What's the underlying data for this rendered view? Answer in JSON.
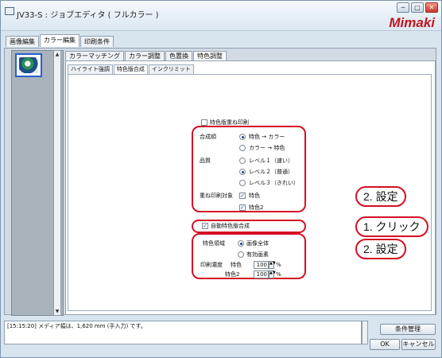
{
  "window": {
    "title": "JV33-S : ジョブエディタ ( フルカラー )",
    "brand": "Mimaki",
    "controls": [
      "─",
      "□",
      "✕"
    ]
  },
  "main_tabs": [
    {
      "label": "画像編集",
      "active": false
    },
    {
      "label": "カラー編集",
      "active": true
    },
    {
      "label": "印刷条件",
      "active": false
    }
  ],
  "sub_tabs": [
    {
      "label": "カラーマッチング",
      "active": false
    },
    {
      "label": "カラー調整",
      "active": false
    },
    {
      "label": "色置換",
      "active": false
    },
    {
      "label": "特色調整",
      "active": true
    }
  ],
  "subsub_tabs": [
    {
      "label": "ハイライト強調",
      "active": false
    },
    {
      "label": "特色版合成",
      "active": true
    },
    {
      "label": "インクリミット",
      "active": false
    }
  ],
  "special": {
    "overprint_label": "特色版重ね印刷",
    "compose_order_label": "合成順",
    "compose_options": [
      "特色 → カラー",
      "カラー → 特色"
    ],
    "quality_label": "品質",
    "quality_options": [
      "レベル１（速い）",
      "レベル２（普通）",
      "レベル３（きれい）"
    ],
    "overlay_target_label": "重ね印刷対象",
    "overlay_options": [
      "特色",
      "特色2"
    ],
    "auto_compose_label": "自動特色版合成",
    "special_area_label": "特色領域",
    "area_options": [
      "画像全体",
      "有効画素"
    ],
    "print_density_label": "印刷濃度",
    "density_rows": [
      {
        "label": "特色",
        "value": "100",
        "unit": "%"
      },
      {
        "label": "特色2",
        "value": "100",
        "unit": "%"
      }
    ]
  },
  "callouts": {
    "settings_1": "2. 設定",
    "click": "1. クリック",
    "settings_2": "2. 設定"
  },
  "status_text": "[15:15:20] メディア幅は、1,620 mm (手入力) です。",
  "buttons": {
    "conditions": "条件管理",
    "ok": "OK",
    "cancel": "キャンセル"
  },
  "colors": {
    "accent_red": "#d40f24",
    "brand_red": "#c2161d",
    "selection_blue": "#2d5ecc"
  }
}
